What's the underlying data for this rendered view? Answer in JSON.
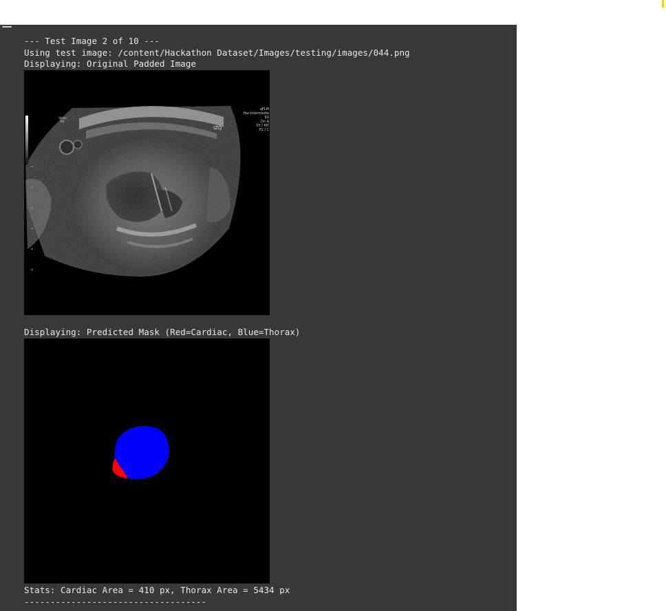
{
  "output": {
    "header": "--- Test Image 2 of 10 ---",
    "using": "Using test image: /content/Hackathon Dataset/Images/testing/images/044.png",
    "display_original": "Displaying: Original Padded Image",
    "display_mask": "Displaying: Predicted Mask (Red=Cardiac, Blue=Thorax)",
    "stats": "Stats: Cardiac Area = 410 px, Thorax Area = 5434 px",
    "separator": "-----------------------------------"
  },
  "ultrasound_overlay": {
    "orientation": "IZQ",
    "left_label_1": "Yelnar",
    "left_label_2": "R4",
    "right_info": [
      "qFLM",
      "Har-intermedia",
      "50",
      "Dn  A",
      "SY / MY",
      "P1 / C"
    ]
  },
  "colors": {
    "panel_bg": "#383838",
    "text": "#e8e8e8",
    "cardiac": "#ff0000",
    "thorax": "#0000ff"
  }
}
